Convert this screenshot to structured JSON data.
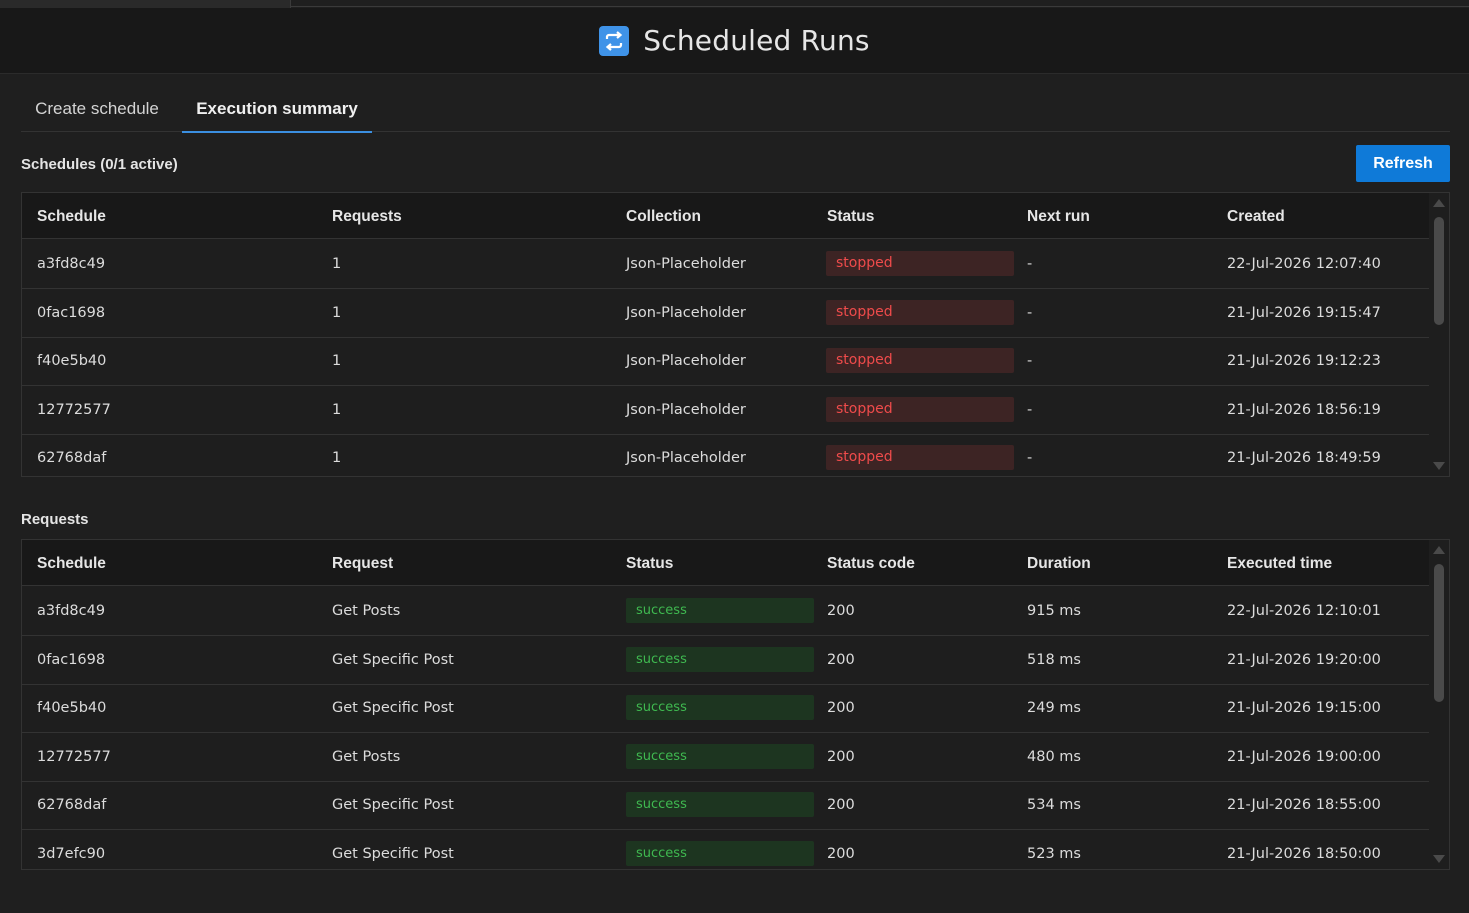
{
  "window": {
    "title": "Scheduled Runs"
  },
  "tabs": [
    {
      "label": "Create schedule",
      "active": false
    },
    {
      "label": "Execution summary",
      "active": true
    }
  ],
  "schedules": {
    "title": "Schedules (0/1 active)",
    "refresh_label": "Refresh",
    "headers": [
      "Schedule",
      "Requests",
      "Collection",
      "Status",
      "Next run",
      "Created"
    ],
    "rows": [
      {
        "schedule": "a3fd8c49",
        "requests": "1",
        "collection": "Json-Placeholder",
        "status": "stopped",
        "next_run": "-",
        "created": "22-Jul-2026 12:07:40"
      },
      {
        "schedule": "0fac1698",
        "requests": "1",
        "collection": "Json-Placeholder",
        "status": "stopped",
        "next_run": "-",
        "created": "21-Jul-2026 19:15:47"
      },
      {
        "schedule": "f40e5b40",
        "requests": "1",
        "collection": "Json-Placeholder",
        "status": "stopped",
        "next_run": "-",
        "created": "21-Jul-2026 19:12:23"
      },
      {
        "schedule": "12772577",
        "requests": "1",
        "collection": "Json-Placeholder",
        "status": "stopped",
        "next_run": "-",
        "created": "21-Jul-2026 18:56:19"
      },
      {
        "schedule": "62768daf",
        "requests": "1",
        "collection": "Json-Placeholder",
        "status": "stopped",
        "next_run": "-",
        "created": "21-Jul-2026 18:49:59"
      }
    ]
  },
  "requests": {
    "title": "Requests",
    "headers": [
      "Schedule",
      "Request",
      "Status",
      "Status code",
      "Duration",
      "Executed time"
    ],
    "rows": [
      {
        "schedule": "a3fd8c49",
        "request": "Get Posts",
        "status": "success",
        "status_code": "200",
        "duration": "915 ms",
        "executed": "22-Jul-2026 12:10:01"
      },
      {
        "schedule": "0fac1698",
        "request": "Get Specific Post",
        "status": "success",
        "status_code": "200",
        "duration": "518 ms",
        "executed": "21-Jul-2026 19:20:00"
      },
      {
        "schedule": "f40e5b40",
        "request": "Get Specific Post",
        "status": "success",
        "status_code": "200",
        "duration": "249 ms",
        "executed": "21-Jul-2026 19:15:00"
      },
      {
        "schedule": "12772577",
        "request": "Get Posts",
        "status": "success",
        "status_code": "200",
        "duration": "480 ms",
        "executed": "21-Jul-2026 19:00:00"
      },
      {
        "schedule": "62768daf",
        "request": "Get Specific Post",
        "status": "success",
        "status_code": "200",
        "duration": "534 ms",
        "executed": "21-Jul-2026 18:55:00"
      },
      {
        "schedule": "3d7efc90",
        "request": "Get Specific Post",
        "status": "success",
        "status_code": "200",
        "duration": "523 ms",
        "executed": "21-Jul-2026 18:50:00"
      }
    ]
  },
  "colors": {
    "accent": "#0f7ad8",
    "stopped": "#ef4b4b",
    "success": "#3fb950",
    "logo": "#3f93e8"
  },
  "icons": {
    "logo": "sync-arrows-icon"
  }
}
